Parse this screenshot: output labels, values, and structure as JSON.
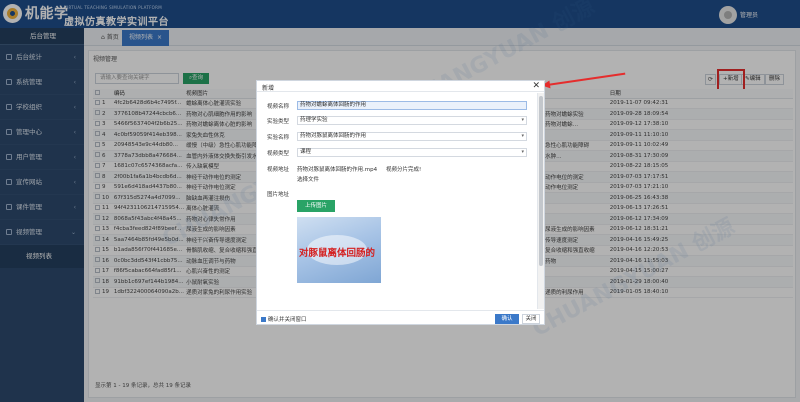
{
  "header": {
    "brand": "机能学",
    "subtitle": "虚拟仿真教学实训平台",
    "english": "VIRTUAL TEACHING SIMULATION PLATFORM",
    "user_name": "管理员"
  },
  "sidebar": {
    "title": "后台管理",
    "items": [
      {
        "label": "后台统计",
        "icon": "chart-icon"
      },
      {
        "label": "系统管理",
        "icon": "gear-icon"
      },
      {
        "label": "学校组织",
        "icon": "org-icon"
      },
      {
        "label": "管理中心",
        "icon": "admin-icon"
      },
      {
        "label": "用户管理",
        "icon": "user-icon"
      },
      {
        "label": "宣传网站",
        "icon": "web-icon"
      },
      {
        "label": "课件管理",
        "icon": "courseware-icon"
      },
      {
        "label": "视频管理",
        "icon": "video-icon"
      }
    ],
    "sub_item": "视频列表"
  },
  "tabs": {
    "home": "首页",
    "active": "视频列表",
    "close": "×"
  },
  "panel": {
    "title": "视频管理",
    "search_placeholder": "请输入要查询关键字",
    "search_button": "查询",
    "refresh": "⟳",
    "add": "+新增",
    "edit": "✎编辑",
    "delete": "删除",
    "footer": "显示第 1 - 19 条记录，总共 19 条记录"
  },
  "table": {
    "columns": [
      "编码",
      "视频图片",
      "",
      "日期"
    ],
    "rows": [
      {
        "idx": "1",
        "id": "4fc2b6428d6b4c7495f...",
        "name": "蟾蜍离体心脏灌流实验",
        "name2": "",
        "date": "2019-11-07 09:42:31"
      },
      {
        "idx": "2",
        "id": "3776108b47244cbcb6...",
        "name": "药物对心肌细胞作用的影响（综合）",
        "name2": "药物对蟾蜍实验",
        "date": "2019-09-28 18:09:54"
      },
      {
        "idx": "3",
        "id": "5466f5637404f2b6b25...",
        "name": "药物对蟾蜍离体心脏的影响",
        "name2": "药物对蟾蜍…",
        "date": "2019-09-12 17:38:10"
      },
      {
        "idx": "4",
        "id": "4c0bf59059f414eb398...",
        "name": "家兔失血性休克",
        "name2": "",
        "date": "2019-09-11 11:10:10"
      },
      {
        "idx": "5",
        "id": "20948543e9c44db80...",
        "name": "缓慢（中级）急性心肌功能障碍",
        "name2": "急性心肌功能障碍",
        "date": "2019-09-11 10:02:49"
      },
      {
        "idx": "6",
        "id": "3778a73dbb8a476684...",
        "name": "血管内外液体交换失衡引发水肿",
        "name2": "水肿…",
        "date": "2019-08-31 17:30:09"
      },
      {
        "idx": "7",
        "id": "1681c07c6574368acfa...",
        "name": "传入缺氧模型",
        "name2": "",
        "date": "2019-08-22 18:15:05"
      },
      {
        "idx": "8",
        "id": "2f00b1fa6a1b4bcdb6d...",
        "name": "神经干动作电位的测定",
        "name2": "动作电位的测定",
        "date": "2019-07-03 17:17:51"
      },
      {
        "idx": "9",
        "id": "591e6d418ad4437b80...",
        "name": "神经干动作电位测定",
        "name2": "动作电位测定",
        "date": "2019-07-03 17:21:10"
      },
      {
        "idx": "10",
        "id": "67f315d5274a4d7099...",
        "name": "脑缺血再灌注损伤",
        "name2": "",
        "date": "2019-06-25 16:43:38"
      },
      {
        "idx": "11",
        "id": "94f4231106214715954...",
        "name": "离体心脏灌流",
        "name2": "",
        "date": "2019-06-13 17:26:51"
      },
      {
        "idx": "12",
        "id": "8068a5f43abc4f48a45...",
        "name": "药物对心律失常作用",
        "name2": "",
        "date": "2019-06-12 17:34:09"
      },
      {
        "idx": "13",
        "id": "f4cba3feed824f89beef...",
        "name": "尿液生成的影响因素",
        "name2": "尿液生成的影响因素",
        "date": "2019-06-12 18:31:21"
      },
      {
        "idx": "14",
        "id": "5aa7464b85fd49e5b0d...",
        "name": "神经干兴奋传导速度测定",
        "name2": "传导速度测定",
        "date": "2019-04-16 15:49:25"
      },
      {
        "idx": "15",
        "id": "b1ada856f70f441685e...",
        "name": "骨骼肌收缩、复合收缩和强直收缩",
        "name2": "复合收缩和强直收缩",
        "date": "2019-04-16 12:20:53"
      },
      {
        "idx": "16",
        "id": "0c0bc3dd543f41cbb75...",
        "name": "动脉血压调节与药物",
        "name2": "药物",
        "date": "2019-04-16 11:55:03"
      },
      {
        "idx": "17",
        "id": "f86f5cabac664fad85f1...",
        "name": "心肌兴奋性的测定",
        "name2": "",
        "date": "2019-04-15 15:00:27"
      },
      {
        "idx": "18",
        "id": "91bb1c697ef144b1984...",
        "name": "小鼠耐氧实验",
        "name2": "",
        "date": "2019-01-29 18:00:40"
      },
      {
        "idx": "19",
        "id": "1dbf322400064090a2b...",
        "name": "递质对家兔的利尿作用实验",
        "name2": "递质的利尿作用",
        "date": "2019-01-05 18:40:10"
      }
    ]
  },
  "modal": {
    "title": "新增",
    "close": "✕",
    "fields": {
      "video_name_label": "视频名称",
      "video_name_value": "药物对蟾蜍离体回肠的作用",
      "exp_type_label": "实验类型",
      "exp_type_value": "药理学实验",
      "exp_name_label": "实验名称",
      "exp_name_value": "药物对豚鼠离体回肠的作用",
      "video_type_label": "视频类型",
      "video_type_value": "课程",
      "video_addr_label": "视频地址",
      "video_file": "药物对豚鼠离体回肠的作用.mp4",
      "video_status": "视频分片完成!",
      "choose_file": "选择文件",
      "image_addr_label": "图片地址",
      "upload_button": "上传图片",
      "preview_text": "对豚鼠离体回肠的"
    },
    "footer": {
      "confirm_close": "确认并关闭窗口",
      "ok": "确认",
      "close": "关闭"
    }
  },
  "watermark": "CHUANGYUAN 创源"
}
